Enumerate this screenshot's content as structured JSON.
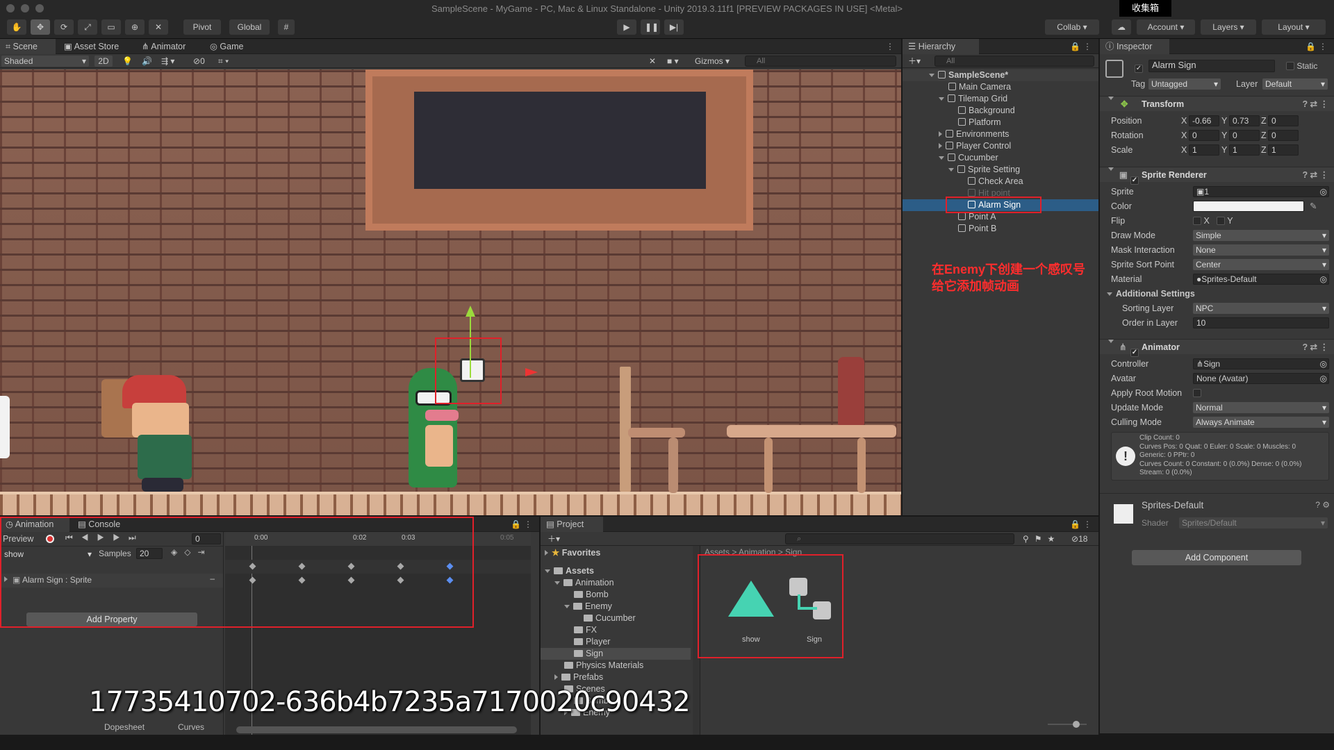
{
  "window": {
    "title": "SampleScene - MyGame - PC, Mac & Linux Standalone - Unity 2019.3.11f1 [PREVIEW PACKAGES IN USE] <Metal>",
    "corner_tag": "收集箱"
  },
  "toolbar": {
    "pivot": "Pivot",
    "global": "Global",
    "collab": "Collab",
    "account": "Account",
    "layers": "Layers",
    "layout": "Layout"
  },
  "scene_tabs": [
    "Scene",
    "Asset Store",
    "Animator",
    "Game"
  ],
  "scene_toolbar": {
    "shading": "Shaded",
    "mode2d": "2D",
    "hidden_count": "0",
    "gizmos": "Gizmos",
    "search_placeholder": "All"
  },
  "hierarchy": {
    "tab": "Hierarchy",
    "search_placeholder": "All",
    "scene": "SampleScene*",
    "items": [
      {
        "label": "Main Camera"
      },
      {
        "label": "Tilemap Grid"
      },
      {
        "label": "Background"
      },
      {
        "label": "Platform"
      },
      {
        "label": "Environments"
      },
      {
        "label": "Player Control"
      },
      {
        "label": "Cucumber"
      },
      {
        "label": "Sprite Setting"
      },
      {
        "label": "Check Area"
      },
      {
        "label": "Hit point"
      },
      {
        "label": "Alarm Sign"
      },
      {
        "label": "Point A"
      },
      {
        "label": "Point B"
      }
    ]
  },
  "annotation": {
    "line1": "在Enemy下创建一个感叹号",
    "line2": "给它添加帧动画",
    "color": "#ff2d2d"
  },
  "inspector": {
    "tab": "Inspector",
    "object_name": "Alarm Sign",
    "static": "Static",
    "tag_label": "Tag",
    "tag": "Untagged",
    "layer_label": "Layer",
    "layer": "Default",
    "transform": {
      "title": "Transform",
      "position": {
        "label": "Position",
        "x": "-0.66",
        "y": "0.73",
        "z": "0"
      },
      "rotation": {
        "label": "Rotation",
        "x": "0",
        "y": "0",
        "z": "0"
      },
      "scale": {
        "label": "Scale",
        "x": "1",
        "y": "1",
        "z": "1"
      }
    },
    "sprite_renderer": {
      "title": "Sprite Renderer",
      "sprite_label": "Sprite",
      "sprite": "1",
      "color_label": "Color",
      "flip_label": "Flip",
      "flip_x": "X",
      "flip_y": "Y",
      "draw_mode_label": "Draw Mode",
      "draw_mode": "Simple",
      "mask_label": "Mask Interaction",
      "mask": "None",
      "sort_point_label": "Sprite Sort Point",
      "sort_point": "Center",
      "material_label": "Material",
      "material": "Sprites-Default",
      "additional": "Additional Settings",
      "sorting_layer_label": "Sorting Layer",
      "sorting_layer": "NPC",
      "order_label": "Order in Layer",
      "order": "10"
    },
    "animator": {
      "title": "Animator",
      "controller_label": "Controller",
      "controller": "Sign",
      "avatar_label": "Avatar",
      "avatar": "None (Avatar)",
      "root_motion_label": "Apply Root Motion",
      "update_label": "Update Mode",
      "update": "Normal",
      "culling_label": "Culling Mode",
      "culling": "Always Animate",
      "info": [
        "Clip Count: 0",
        "Curves Pos: 0 Quat: 0 Euler: 0 Scale: 0 Muscles: 0",
        "Generic: 0 PPtr: 0",
        "Curves Count: 0 Constant: 0 (0.0%) Dense: 0 (0.0%)",
        "Stream: 0 (0.0%)"
      ]
    },
    "material": {
      "name": "Sprites-Default",
      "shader_label": "Shader",
      "shader": "Sprites/Default"
    },
    "add_component": "Add Component"
  },
  "animation": {
    "tabs": [
      "Animation",
      "Console"
    ],
    "preview": "Preview",
    "frame": "0",
    "clip": "show",
    "samples_label": "Samples",
    "samples": "20",
    "property": "Alarm Sign : Sprite",
    "add_property": "Add Property",
    "time_labels": [
      "0:00",
      "0:02",
      "0:03",
      "0:05"
    ],
    "bottom_tabs": [
      "Dopesheet",
      "Curves"
    ]
  },
  "project": {
    "tab": "Project",
    "count": "18",
    "favorites": "Favorites",
    "breadcrumb": [
      "Assets",
      "Animation",
      "Sign"
    ],
    "tree": [
      {
        "label": "Assets"
      },
      {
        "label": "Animation"
      },
      {
        "label": "Bomb"
      },
      {
        "label": "Enemy"
      },
      {
        "label": "Cucumber"
      },
      {
        "label": "FX"
      },
      {
        "label": "Player"
      },
      {
        "label": "Sign"
      },
      {
        "label": "Physics Materials"
      },
      {
        "label": "Prefabs"
      },
      {
        "label": "Scenes"
      },
      {
        "label": "Bomb"
      },
      {
        "label": "Enemy"
      }
    ],
    "assets": [
      {
        "name": "show"
      },
      {
        "name": "Sign"
      }
    ]
  },
  "overlay_text": "17735410702-636b4b7235a7170020c90432"
}
